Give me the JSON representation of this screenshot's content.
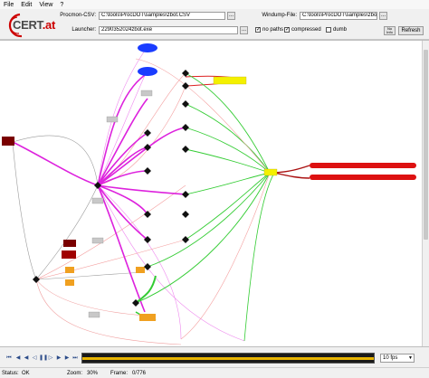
{
  "menu": [
    "File",
    "Edit",
    "View",
    "?"
  ],
  "logo": {
    "main": "CERT",
    "suffix": ".at"
  },
  "procmon": {
    "label": "Procmon-CSV:",
    "value": "C:\\tools\\ProcDOT\\samples\\zbot.CSV"
  },
  "windump": {
    "label": "Windump-File:",
    "value": "C:\\tools\\ProcDOT\\samples\\zbot.pcap"
  },
  "launcher": {
    "label": "Launcher:",
    "value": "2290352024zbot.exe"
  },
  "options": {
    "no_paths": {
      "label": "no paths",
      "checked": true
    },
    "compressed": {
      "label": "compressed",
      "checked": true
    },
    "dumb": {
      "label": "dumb",
      "checked": false
    }
  },
  "buttons": {
    "browse": "...",
    "refresh": "Refresh",
    "info": "No Info"
  },
  "playback": {
    "speed": "10 fps",
    "progress": 1.0,
    "controls": [
      "rewind",
      "step-back",
      "step-back",
      "play-back",
      "pause",
      "play",
      "step",
      "step",
      "forward"
    ]
  },
  "status": {
    "status_label": "Status:",
    "status_value": "OK",
    "zoom_label": "Zoom:",
    "zoom_value": "30%",
    "frame_label": "Frame:",
    "frame_value": "0/776"
  },
  "colors": {
    "accent_red": "#cc0000",
    "edge_magenta": "#dd22dd",
    "edge_green": "#33cc33",
    "node_yellow": "#f4f000",
    "node_orange": "#f0a020",
    "node_blue": "#1a3cff",
    "timeline": "#e8b400"
  }
}
